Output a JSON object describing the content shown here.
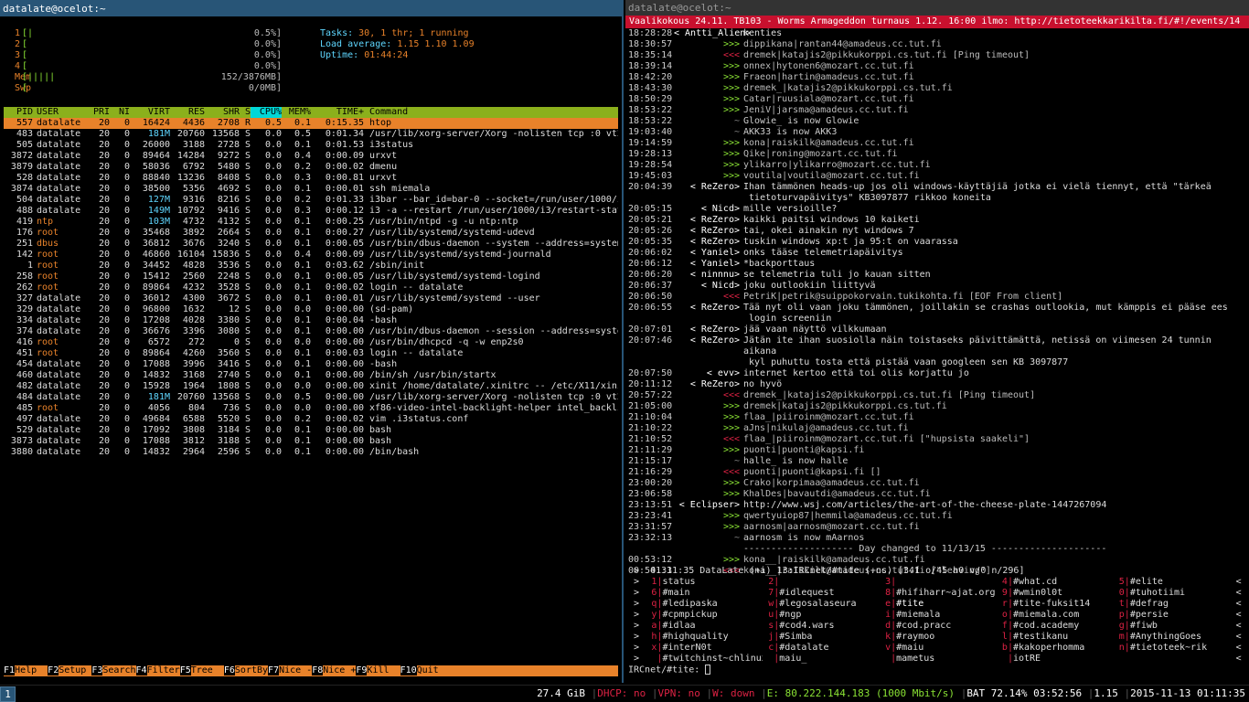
{
  "left_title": "datalate@ocelot:~",
  "right_title": "datalate@ocelot:~",
  "htop": {
    "cpus": [
      {
        "label": "1",
        "bar": "[|",
        "pct": "0.5%]"
      },
      {
        "label": "2",
        "bar": "[",
        "pct": "0.0%]"
      },
      {
        "label": "3",
        "bar": "[",
        "pct": "0.0%]"
      },
      {
        "label": "4",
        "bar": "[",
        "pct": "0.0%]"
      }
    ],
    "mem": {
      "label": "Mem",
      "bar": "[|||||",
      "pct": "152/3876MB]"
    },
    "swp": {
      "label": "Swp",
      "bar": "[",
      "pct": "0/0MB]"
    },
    "tasks_label": "Tasks:",
    "tasks_value": "30, 1 thr; 1 running",
    "load_label": "Load average:",
    "load_value": "1.15 1.10 1.09",
    "uptime_label": "Uptime:",
    "uptime_value": "01:44:24",
    "columns": [
      "PID",
      "USER",
      "PRI",
      "NI",
      "VIRT",
      "RES",
      "SHR",
      "S",
      "CPU%",
      "MEM%",
      "TIME+",
      "Command"
    ],
    "rows": [
      [
        "557",
        "datalate",
        "20",
        "0",
        "16424",
        "4436",
        "2708",
        "R",
        "0.5",
        "0.1",
        "0:15.35",
        "htop"
      ],
      [
        "483",
        "datalate",
        "20",
        "0",
        "181M",
        "20760",
        "13568",
        "S",
        "0.0",
        "0.5",
        "0:01.34",
        "/usr/lib/xorg-server/Xorg -nolisten tcp :0 vt2 -a"
      ],
      [
        "505",
        "datalate",
        "20",
        "0",
        "26000",
        "3188",
        "2728",
        "S",
        "0.0",
        "0.1",
        "0:01.53",
        "i3status"
      ],
      [
        "3872",
        "datalate",
        "20",
        "0",
        "89464",
        "14284",
        "9272",
        "S",
        "0.0",
        "0.4",
        "0:00.09",
        "urxvt"
      ],
      [
        "3879",
        "datalate",
        "20",
        "0",
        "58036",
        "6792",
        "5480",
        "S",
        "0.0",
        "0.2",
        "0:00.02",
        "dmenu"
      ],
      [
        "528",
        "datalate",
        "20",
        "0",
        "88840",
        "13236",
        "8408",
        "S",
        "0.0",
        "0.3",
        "0:00.81",
        "urxvt"
      ],
      [
        "3874",
        "datalate",
        "20",
        "0",
        "38500",
        "5356",
        "4692",
        "S",
        "0.0",
        "0.1",
        "0:00.01",
        "ssh miemala"
      ],
      [
        "504",
        "datalate",
        "20",
        "0",
        "127M",
        "9316",
        "8216",
        "S",
        "0.0",
        "0.2",
        "0:01.33",
        "i3bar --bar_id=bar-0 --socket=/run/user/1000/i3/i"
      ],
      [
        "488",
        "datalate",
        "20",
        "0",
        "149M",
        "10792",
        "9416",
        "S",
        "0.0",
        "0.3",
        "0:00.12",
        "i3 -a --restart /run/user/1000/i3/restart-state.4"
      ],
      [
        "419",
        "ntp",
        "20",
        "0",
        "103M",
        "4732",
        "4132",
        "S",
        "0.0",
        "0.1",
        "0:00.25",
        "/usr/bin/ntpd -g -u ntp:ntp"
      ],
      [
        "176",
        "root",
        "20",
        "0",
        "35468",
        "3892",
        "2664",
        "S",
        "0.0",
        "0.1",
        "0:00.27",
        "/usr/lib/systemd/systemd-udevd"
      ],
      [
        "251",
        "dbus",
        "20",
        "0",
        "36812",
        "3676",
        "3240",
        "S",
        "0.0",
        "0.1",
        "0:00.05",
        "/usr/bin/dbus-daemon --system --address=systemd:"
      ],
      [
        "142",
        "root",
        "20",
        "0",
        "46860",
        "16104",
        "15836",
        "S",
        "0.0",
        "0.4",
        "0:00.09",
        "/usr/lib/systemd/systemd-journald"
      ],
      [
        "1",
        "root",
        "20",
        "0",
        "34452",
        "4828",
        "3536",
        "S",
        "0.0",
        "0.1",
        "0:03.62",
        "/sbin/init"
      ],
      [
        "258",
        "root",
        "20",
        "0",
        "15412",
        "2560",
        "2248",
        "S",
        "0.0",
        "0.1",
        "0:00.05",
        "/usr/lib/systemd/systemd-logind"
      ],
      [
        "262",
        "root",
        "20",
        "0",
        "89864",
        "4232",
        "3528",
        "S",
        "0.0",
        "0.1",
        "0:00.02",
        "login -- datalate"
      ],
      [
        "327",
        "datalate",
        "20",
        "0",
        "36012",
        "4300",
        "3672",
        "S",
        "0.0",
        "0.1",
        "0:00.01",
        "/usr/lib/systemd/systemd --user"
      ],
      [
        "329",
        "datalate",
        "20",
        "0",
        "96800",
        "1632",
        "12",
        "S",
        "0.0",
        "0.0",
        "0:00.00",
        "(sd-pam)"
      ],
      [
        "334",
        "datalate",
        "20",
        "0",
        "17208",
        "4028",
        "3380",
        "S",
        "0.0",
        "0.1",
        "0:00.04",
        "-bash"
      ],
      [
        "374",
        "datalate",
        "20",
        "0",
        "36676",
        "3396",
        "3080",
        "S",
        "0.0",
        "0.1",
        "0:00.00",
        "/usr/bin/dbus-daemon --session --address=systemd:"
      ],
      [
        "416",
        "root",
        "20",
        "0",
        "6572",
        "272",
        "0",
        "S",
        "0.0",
        "0.0",
        "0:00.00",
        "/usr/bin/dhcpcd -q -w enp2s0"
      ],
      [
        "451",
        "root",
        "20",
        "0",
        "89864",
        "4260",
        "3560",
        "S",
        "0.0",
        "0.1",
        "0:00.03",
        "login -- datalate"
      ],
      [
        "454",
        "datalate",
        "20",
        "0",
        "17088",
        "3996",
        "3416",
        "S",
        "0.0",
        "0.1",
        "0:00.00",
        "-bash"
      ],
      [
        "460",
        "datalate",
        "20",
        "0",
        "14832",
        "3168",
        "2740",
        "S",
        "0.0",
        "0.1",
        "0:00.00",
        "/bin/sh /usr/bin/startx"
      ],
      [
        "482",
        "datalate",
        "20",
        "0",
        "15928",
        "1964",
        "1808",
        "S",
        "0.0",
        "0.0",
        "0:00.00",
        "xinit /home/datalate/.xinitrc -- /etc/X11/xinit/x"
      ],
      [
        "484",
        "datalate",
        "20",
        "0",
        "181M",
        "20760",
        "13568",
        "S",
        "0.0",
        "0.5",
        "0:00.00",
        "/usr/lib/xorg-server/Xorg -nolisten tcp :0 vt2 -a"
      ],
      [
        "485",
        "root",
        "20",
        "0",
        "4056",
        "804",
        "736",
        "S",
        "0.0",
        "0.0",
        "0:00.00",
        "xf86-video-intel-backlight-helper intel_backlight"
      ],
      [
        "497",
        "datalate",
        "20",
        "0",
        "49684",
        "6588",
        "5520",
        "S",
        "0.0",
        "0.2",
        "0:00.02",
        "vim .i3status.conf"
      ],
      [
        "529",
        "datalate",
        "20",
        "0",
        "17092",
        "3808",
        "3184",
        "S",
        "0.0",
        "0.1",
        "0:00.00",
        "bash"
      ],
      [
        "3873",
        "datalate",
        "20",
        "0",
        "17088",
        "3812",
        "3188",
        "S",
        "0.0",
        "0.1",
        "0:00.00",
        "bash"
      ],
      [
        "3880",
        "datalate",
        "20",
        "0",
        "14832",
        "2964",
        "2596",
        "S",
        "0.0",
        "0.1",
        "0:00.00",
        "/bin/bash"
      ]
    ],
    "fkeys": [
      {
        "k": "F1",
        "l": "Help  "
      },
      {
        "k": "F2",
        "l": "Setup "
      },
      {
        "k": "F3",
        "l": "Search"
      },
      {
        "k": "F4",
        "l": "Filter"
      },
      {
        "k": "F5",
        "l": "Tree  "
      },
      {
        "k": "F6",
        "l": "SortBy"
      },
      {
        "k": "F7",
        "l": "Nice -"
      },
      {
        "k": "F8",
        "l": "Nice +"
      },
      {
        "k": "F9",
        "l": "Kill  "
      },
      {
        "k": "F10",
        "l": "Quit"
      }
    ]
  },
  "irc": {
    "topic": "Vaalikokous 24.11. TB103 - Worms Armageddon turnaus 1.12. 16:00 ilmo: http://tietoteekkarikilta.fi/#!/events/14",
    "messages": [
      {
        "t": "18:28:28",
        "n": "< Antti_Alien>",
        "nc": "white",
        "x": "kenties"
      },
      {
        "t": "18:30:57",
        "n": ">>>",
        "nc": "green",
        "x": "dippikana|rantan44@amadeus.cc.tut.fi"
      },
      {
        "t": "18:35:14",
        "n": "<<<",
        "nc": "red",
        "x": "dremek|katajis2@pikkukorppi.cs.tut.fi [Ping timeout]"
      },
      {
        "t": "18:39:14",
        "n": ">>>",
        "nc": "green",
        "x": "onnex|hytonen6@mozart.cc.tut.fi"
      },
      {
        "t": "18:42:20",
        "n": ">>>",
        "nc": "green",
        "x": "Fraeon|hartin@amadeus.cc.tut.fi"
      },
      {
        "t": "18:43:30",
        "n": ">>>",
        "nc": "green",
        "x": "dremek_|katajis2@pikkukorppi.cs.tut.fi"
      },
      {
        "t": "18:50:29",
        "n": ">>>",
        "nc": "green",
        "x": "Catar|ruusiala@mozart.cc.tut.fi"
      },
      {
        "t": "18:53:22",
        "n": ">>>",
        "nc": "green",
        "x": "JeniV|jarsma@amadeus.cc.tut.fi"
      },
      {
        "t": "18:53:22",
        "n": "~",
        "nc": "grey",
        "x": "Glowie_ is now Glowie"
      },
      {
        "t": "19:03:40",
        "n": "~",
        "nc": "grey",
        "x": "AKK33 is now AKK3"
      },
      {
        "t": "19:14:59",
        "n": ">>>",
        "nc": "green",
        "x": "kona|raiskilk@amadeus.cc.tut.fi"
      },
      {
        "t": "19:28:13",
        "n": ">>>",
        "nc": "green",
        "x": "Qike|roning@mozart.cc.tut.fi"
      },
      {
        "t": "19:28:54",
        "n": ">>>",
        "nc": "green",
        "x": "ylikarro|ylikarro@mozart.cc.tut.fi"
      },
      {
        "t": "19:45:03",
        "n": ">>>",
        "nc": "green",
        "x": "voutila|voutila@mozart.cc.tut.fi"
      },
      {
        "t": "20:04:39",
        "n": "< ReZero>",
        "nc": "white",
        "x": "Ihan tämmönen heads-up jos oli windows-käyttäjiä jotka ei vielä tiennyt, että \"tärkeä\n tietoturvapäivitys\" KB3097877 rikkoo koneita"
      },
      {
        "t": "20:05:15",
        "n": "< Nicd>",
        "nc": "white",
        "x": "mille versioille?"
      },
      {
        "t": "20:05:21",
        "n": "< ReZero>",
        "nc": "white",
        "x": "kaikki paitsi windows 10 kaiketi"
      },
      {
        "t": "20:05:26",
        "n": "< ReZero>",
        "nc": "white",
        "x": "tai, okei ainakin nyt windows 7"
      },
      {
        "t": "20:05:35",
        "n": "< ReZero>",
        "nc": "white",
        "x": "tuskin windows xp:t ja 95:t on vaarassa"
      },
      {
        "t": "20:06:02",
        "n": "< Yaniel>",
        "nc": "white",
        "x": "onks tääse telemetriapäivitys"
      },
      {
        "t": "20:06:12",
        "n": "< Yaniel>",
        "nc": "white",
        "x": "*backporttaus"
      },
      {
        "t": "20:06:20",
        "n": "< ninnnu>",
        "nc": "white",
        "x": "se telemetria tuli jo kauan sitten"
      },
      {
        "t": "20:06:37",
        "n": "< Nicd>",
        "nc": "white",
        "x": "joku outlookiin liittyvä"
      },
      {
        "t": "20:06:50",
        "n": "<<<",
        "nc": "red",
        "x": "PetriK|petrik@suippokorvain.tukikohta.fi [EOF From client]"
      },
      {
        "t": "20:06:55",
        "n": "< ReZero>",
        "nc": "white",
        "x": "Tää nyt oli vaan joku tämmönen, joillakin se crashas outlookia, mut kämppis ei pääse ees\n login screeniin"
      },
      {
        "t": "20:07:01",
        "n": "< ReZero>",
        "nc": "white",
        "x": "jää vaan näyttö vilkkumaan"
      },
      {
        "t": "20:07:46",
        "n": "< ReZero>",
        "nc": "white",
        "x": "Jätän ite ihan suosiolla näin toistaseks päivittämättä, netissä on viimesen 24 tunnin aikana\n kyl puhuttu tosta että pistää vaan googleen sen KB 3097877"
      },
      {
        "t": "20:07:50",
        "n": "< evv>",
        "nc": "white",
        "x": "internet kertoo että toi olis korjattu jo"
      },
      {
        "t": "20:11:12",
        "n": "< ReZero>",
        "nc": "white",
        "x": "no hyvö"
      },
      {
        "t": "20:57:22",
        "n": "<<<",
        "nc": "red",
        "x": "dremek_|katajis2@pikkukorppi.cs.tut.fi [Ping timeout]"
      },
      {
        "t": "21:05:00",
        "n": ">>>",
        "nc": "green",
        "x": "dremek|katajis2@pikkukorppi.cs.tut.fi"
      },
      {
        "t": "21:10:04",
        "n": ">>>",
        "nc": "green",
        "x": "flaa_|piiroinm@mozart.cc.tut.fi"
      },
      {
        "t": "21:10:22",
        "n": ">>>",
        "nc": "green",
        "x": "aJns|nikulaj@amadeus.cc.tut.fi"
      },
      {
        "t": "21:10:52",
        "n": "<<<",
        "nc": "red",
        "x": "flaa_|piiroinm@mozart.cc.tut.fi [\"hupsista saakeli\"]"
      },
      {
        "t": "21:11:29",
        "n": ">>>",
        "nc": "green",
        "x": "puonti|puonti@kapsi.fi"
      },
      {
        "t": "21:15:17",
        "n": "~",
        "nc": "grey",
        "x": "halle_ is now halle"
      },
      {
        "t": "21:16:29",
        "n": "<<<",
        "nc": "red",
        "x": "puonti|puonti@kapsi.fi []"
      },
      {
        "t": "23:00:20",
        "n": ">>>",
        "nc": "green",
        "x": "Crako|korpimaa@amadeus.cc.tut.fi"
      },
      {
        "t": "23:06:58",
        "n": ">>>",
        "nc": "green",
        "x": "KhalDes|bavautdi@amadeus.cc.tut.fi"
      },
      {
        "t": "23:13:51",
        "n": "< Eclipser>",
        "nc": "white",
        "x": "http://www.wsj.com/articles/the-art-of-the-cheese-plate-1447267094"
      },
      {
        "t": "23:23:41",
        "n": ">>>",
        "nc": "green",
        "x": "qwertyuiop87|hemmila@amadeus.cc.tut.fi"
      },
      {
        "t": "23:31:57",
        "n": ">>>",
        "nc": "green",
        "x": "aarnosm|aarnosm@mozart.cc.tut.fi"
      },
      {
        "t": "23:32:13",
        "n": "~",
        "nc": "grey",
        "x": "aarnosm is now mAarnos"
      },
      {
        "t": "",
        "n": "",
        "nc": "grey",
        "x": "-------------------- Day changed to 11/13/15 ---------------------"
      },
      {
        "t": "00:53:12",
        "n": ">>>",
        "nc": "green",
        "x": "kona__|raiskilk@amadeus.cc.tut.fi"
      },
      {
        "t": "00:54:33",
        "n": "<<<",
        "nc": "red",
        "x": "kona__|raiskilk@amadeus.cc.tut.fi [\"leaving\"]"
      }
    ],
    "status_line": " >  01:11:35 DataLate (+i) 13:IRCnet/#tite (+ns) [341 o/45 h0 v/0 n/296]",
    "windows": [
      [
        " 1|status",
        " 2|",
        " 3|",
        " 4|#what.cd",
        " 5|#elite"
      ],
      [
        " 6|#main",
        " 7|#idlequest",
        " 8|#hifiharr~ajat.org",
        " 9|#wmin0l0t",
        " 0|#tuhotiimi"
      ],
      [
        " q|#ledipaska",
        " w|#legosalaseura",
        " e|#tite",
        " r|#tite-fuksit14",
        " t|#defrag"
      ],
      [
        " y|#cpmpickup",
        " u|#ngp",
        " i|#miemala",
        " o|#miemala.com",
        " p|#persie"
      ],
      [
        " a|#idlaa",
        " s|#cod4.wars",
        " d|#cod.pracc",
        " f|#cod.academy",
        " g|#fiwb"
      ],
      [
        " h|#highquality",
        " j|#Simba",
        " k|#raymoo",
        " l|#testikanu",
        " m|#AnythingGoes"
      ],
      [
        " x|#interN0t",
        " c|#datalate",
        " v|#maiu",
        " b|#kakoperhomma",
        " n|#tietoteek~rik"
      ],
      [
        "  |#twitchinst~chlinux",
        "  |maiu_",
        "  |mametus",
        "  |iotRE",
        ""
      ]
    ],
    "input_prompt": "IRCnet/#tite"
  },
  "bar": {
    "workspace": "1",
    "disk": "27.4 GiB",
    "dhcp": "DHCP: no",
    "vpn": "VPN: no",
    "wlan": "W: down",
    "eth": "E: 80.222.144.183 (1000 Mbit/s)",
    "bat": "BAT 72.14% 03:52:56",
    "load": "1.15",
    "datetime": "2015-11-13 01:11:35"
  },
  "colors": {
    "accent": "#285577",
    "htop_orange": "#e8822a",
    "htop_green": "#8bb01c",
    "irc_topic": "#c8102e"
  }
}
